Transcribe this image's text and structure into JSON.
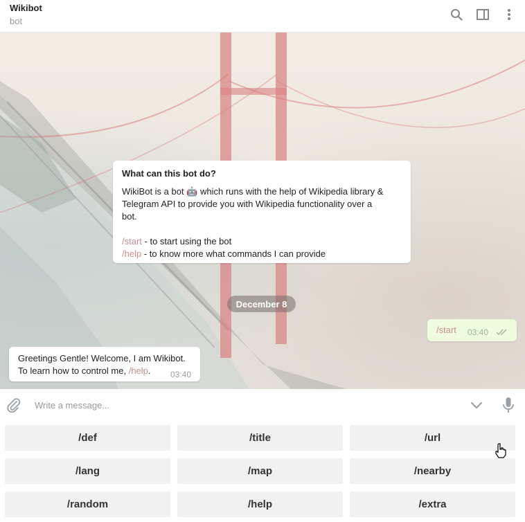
{
  "header": {
    "title": "Wikibot",
    "subtitle": "bot",
    "icons": [
      "search-icon",
      "sidebar-toggle-icon",
      "more-vertical-icon"
    ]
  },
  "intro": {
    "question": "What can this bot do?",
    "desc_line1_pre": "WikiBot is a bot ",
    "desc_emoji": "🤖",
    "desc_line1_post": " which runs with the help of Wikipedia library &",
    "desc_line2": "Telegram API to provide you with Wikipedia functionality over a",
    "desc_line3": "bot.",
    "start_cmd": "/start",
    "start_text": " - to start using the bot",
    "help_cmd": "/help",
    "help_text": " - to know more what commands I can provide"
  },
  "date_separator": "December 8",
  "outgoing": {
    "text": "/start",
    "time": "03:40",
    "status": "read"
  },
  "incoming": {
    "line1": "Greetings Gentle! Welcome, I am Wikibot.",
    "line2_pre": "To learn how to control me, ",
    "line2_cmd": "/help",
    "line2_post": ".",
    "time": "03:40"
  },
  "composer": {
    "placeholder": "Write a message...",
    "value": ""
  },
  "keyboard": {
    "rows": [
      [
        "/def",
        "/title",
        "/url"
      ],
      [
        "/lang",
        "/map",
        "/nearby"
      ],
      [
        "/random",
        "/help",
        "/extra"
      ]
    ]
  },
  "colors": {
    "command_link": "#c98d8d",
    "outgoing_bubble": "#effdde",
    "button_bg": "#f1f1f1"
  }
}
